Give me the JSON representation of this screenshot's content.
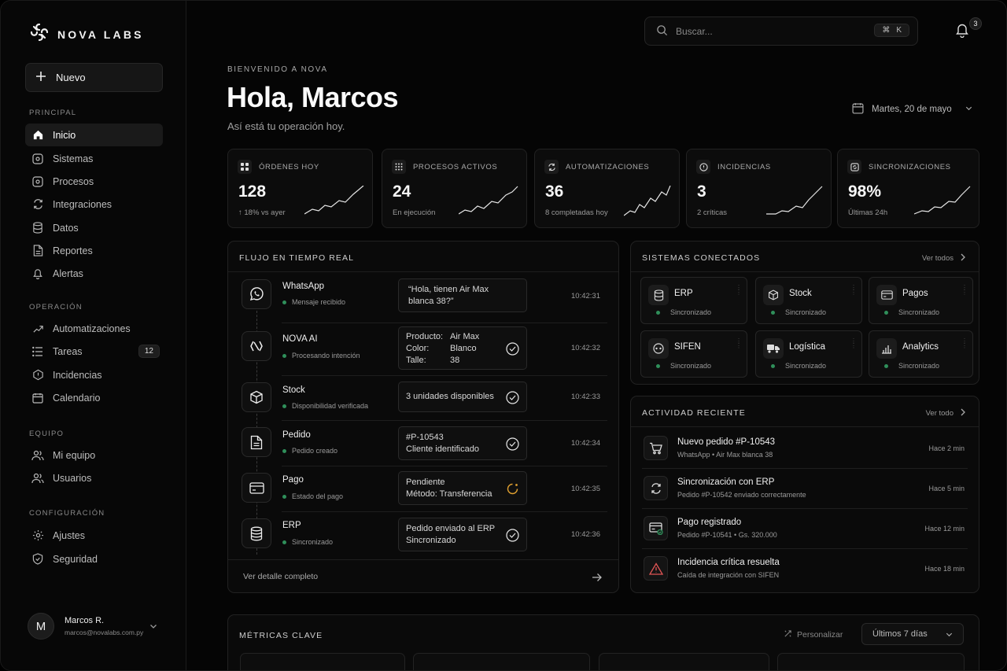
{
  "brand": {
    "name": "NOVA LABS"
  },
  "sidebar": {
    "new_label": "Nuevo",
    "sections": {
      "principal": "PRINCIPAL",
      "operacion": "OPERACIÓN",
      "equipo": "EQUIPO",
      "config": "CONFIGURACIÓN"
    },
    "items": {
      "inicio": "Inicio",
      "sistemas": "Sistemas",
      "procesos": "Procesos",
      "integraciones": "Integraciones",
      "datos": "Datos",
      "reportes": "Reportes",
      "alertas": "Alertas",
      "automatizaciones": "Automatizaciones",
      "tareas": "Tareas",
      "tareas_badge": "12",
      "incidencias": "Incidencias",
      "calendario": "Calendario",
      "mi_equipo": "Mi equipo",
      "usuarios": "Usuarios",
      "ajustes": "Ajustes",
      "seguridad": "Seguridad"
    },
    "user": {
      "initial": "M",
      "name": "Marcos R.",
      "email": "marcos@novalabs.com.py"
    }
  },
  "header": {
    "search_placeholder": "Buscar...",
    "kbd_cmd": "⌘",
    "kbd_key": "K",
    "notifications": "3"
  },
  "hero": {
    "welcome": "BIENVENIDO A NOVA",
    "greeting": "Hola, Marcos",
    "subtitle": "Así está tu operación hoy.",
    "date": "Martes, 20 de mayo"
  },
  "kpis": [
    {
      "label": "ÓRDENES HOY",
      "value": "128",
      "sub": "↑  18% vs ayer",
      "icon": "grid-icon"
    },
    {
      "label": "PROCESOS ACTIVOS",
      "value": "24",
      "sub": "En ejecución",
      "icon": "dots-grid-icon"
    },
    {
      "label": "AUTOMATIZACIONES",
      "value": "36",
      "sub": "8 completadas hoy",
      "icon": "automation-icon"
    },
    {
      "label": "INCIDENCIAS",
      "value": "3",
      "sub": "2 críticas",
      "icon": "alert-circle-icon"
    },
    {
      "label": "SINCRONIZACIONES",
      "value": "98%",
      "sub": "Últimas 24h",
      "icon": "sync-icon"
    }
  ],
  "flow": {
    "title": "FLUJO EN TIEMPO REAL",
    "footer": "Ver detalle completo",
    "rows": [
      {
        "name": "WhatsApp",
        "status": "Mensaje recibido",
        "box1": "“Hola, tienen Air Max",
        "box2": "blanca 38?”",
        "time": "10:42:31"
      },
      {
        "name": "NOVA AI",
        "status": "Procesando intención",
        "k1": "Producto:",
        "v1": "Air Max",
        "k2": "Color:",
        "v2": "Blanco",
        "k3": "Talle:",
        "v3": "38",
        "time": "10:42:32"
      },
      {
        "name": "Stock",
        "status": "Disponibilidad verificada",
        "box1": "3 unidades disponibles",
        "time": "10:42:33"
      },
      {
        "name": "Pedido",
        "status": "Pedido creado",
        "box1": "#P-10543",
        "box2": "Cliente identificado",
        "time": "10:42:34"
      },
      {
        "name": "Pago",
        "status": "Estado del pago",
        "box1": "Pendiente",
        "box2": "Método: Transferencia",
        "time": "10:42:35"
      },
      {
        "name": "ERP",
        "status": "Sincronizado",
        "box1": "Pedido enviado al ERP",
        "box2": "Sincronizado",
        "time": "10:42:36"
      }
    ]
  },
  "systems": {
    "title": "SISTEMAS CONECTADOS",
    "link": "Ver todos",
    "items": [
      {
        "name": "ERP",
        "status": "Sincronizado"
      },
      {
        "name": "Stock",
        "status": "Sincronizado"
      },
      {
        "name": "Pagos",
        "status": "Sincronizado"
      },
      {
        "name": "SIFEN",
        "status": "Sincronizado"
      },
      {
        "name": "Logística",
        "status": "Sincronizado"
      },
      {
        "name": "Analytics",
        "status": "Sincronizado"
      }
    ]
  },
  "activity": {
    "title": "ACTIVIDAD RECIENTE",
    "link": "Ver todo",
    "items": [
      {
        "title": "Nuevo pedido #P-10543",
        "sub": "WhatsApp  •  Air Max blanca 38",
        "time": "Hace 2 min"
      },
      {
        "title": "Sincronización con ERP",
        "sub": "Pedido #P-10542 enviado correctamente",
        "time": "Hace 5 min"
      },
      {
        "title": "Pago registrado",
        "sub": "Pedido #P-10541  •  Gs. 320.000",
        "time": "Hace 12 min"
      },
      {
        "title": "Incidencia crítica resuelta",
        "sub": "Caída de integración con SIFEN",
        "time": "Hace 18 min"
      }
    ]
  },
  "metrics": {
    "title": "MÉTRICAS CLAVE",
    "customize": "Personalizar",
    "range": "Últimos 7 días"
  },
  "colors": {
    "accent_green": "#2f8f5a",
    "warning_red": "#e05555",
    "pending_orange": "#e0a030"
  }
}
